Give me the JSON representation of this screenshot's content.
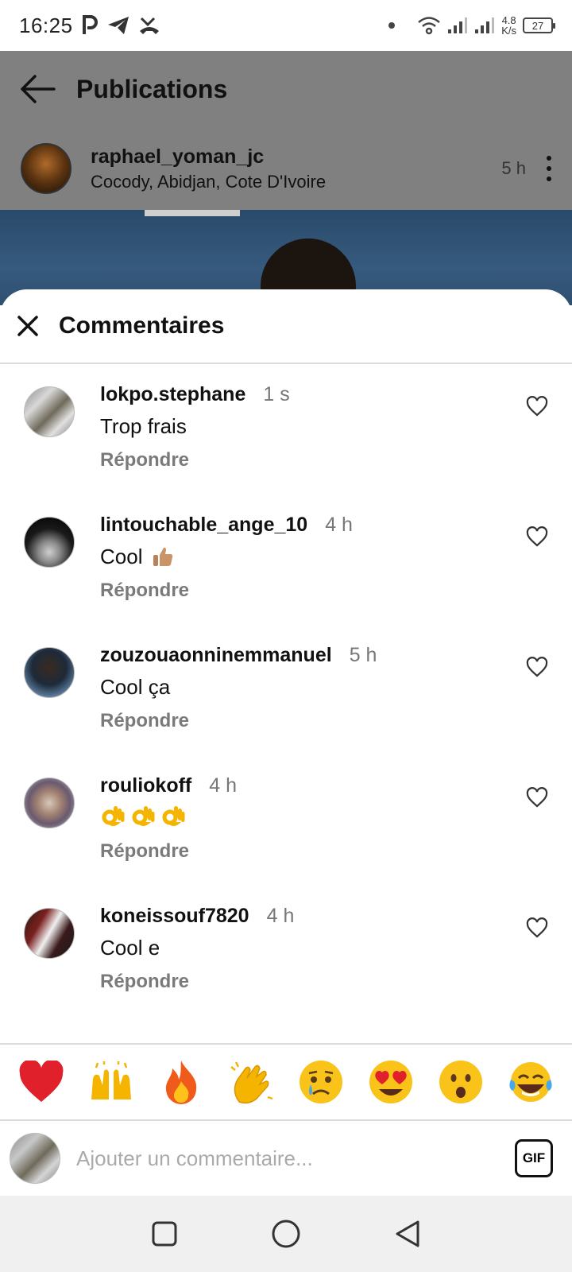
{
  "status_bar": {
    "time": "16:25",
    "net_speed_value": "4.8",
    "net_speed_unit": "K/s",
    "battery": "27"
  },
  "header": {
    "title": "Publications"
  },
  "post": {
    "username": "raphael_yoman_jc",
    "location": "Cocody, Abidjan, Cote D'Ivoire",
    "time": "5 h"
  },
  "sheet": {
    "title": "Commentaires"
  },
  "comments": [
    {
      "username": "lokpo.stephane",
      "time": "1 s",
      "text": "Trop frais",
      "reply": "Répondre"
    },
    {
      "username": "lintouchable_ange_10",
      "time": "4 h",
      "text": "Cool",
      "reply": "Répondre"
    },
    {
      "username": "zouzouaonninemmanuel",
      "time": "5 h",
      "text": "Cool ça",
      "reply": "Répondre"
    },
    {
      "username": "rouliokoff",
      "time": "4 h",
      "text": "",
      "reply": "Répondre"
    },
    {
      "username": "koneissouf7820",
      "time": "4 h",
      "text": "Cool e",
      "reply": "Répondre"
    }
  ],
  "reactions": [
    "red-heart",
    "raising-hands",
    "fire",
    "clapping-hands",
    "crying-face",
    "heart-eyes-face",
    "surprised-face",
    "tears-of-joy-face"
  ],
  "composer": {
    "placeholder": "Ajouter un commentaire...",
    "gif_label": "GIF"
  },
  "colors": {
    "overlay": "#808080",
    "sheet_bg": "#ffffff",
    "muted_text": "#777777",
    "story_ring": "#d4237a"
  }
}
